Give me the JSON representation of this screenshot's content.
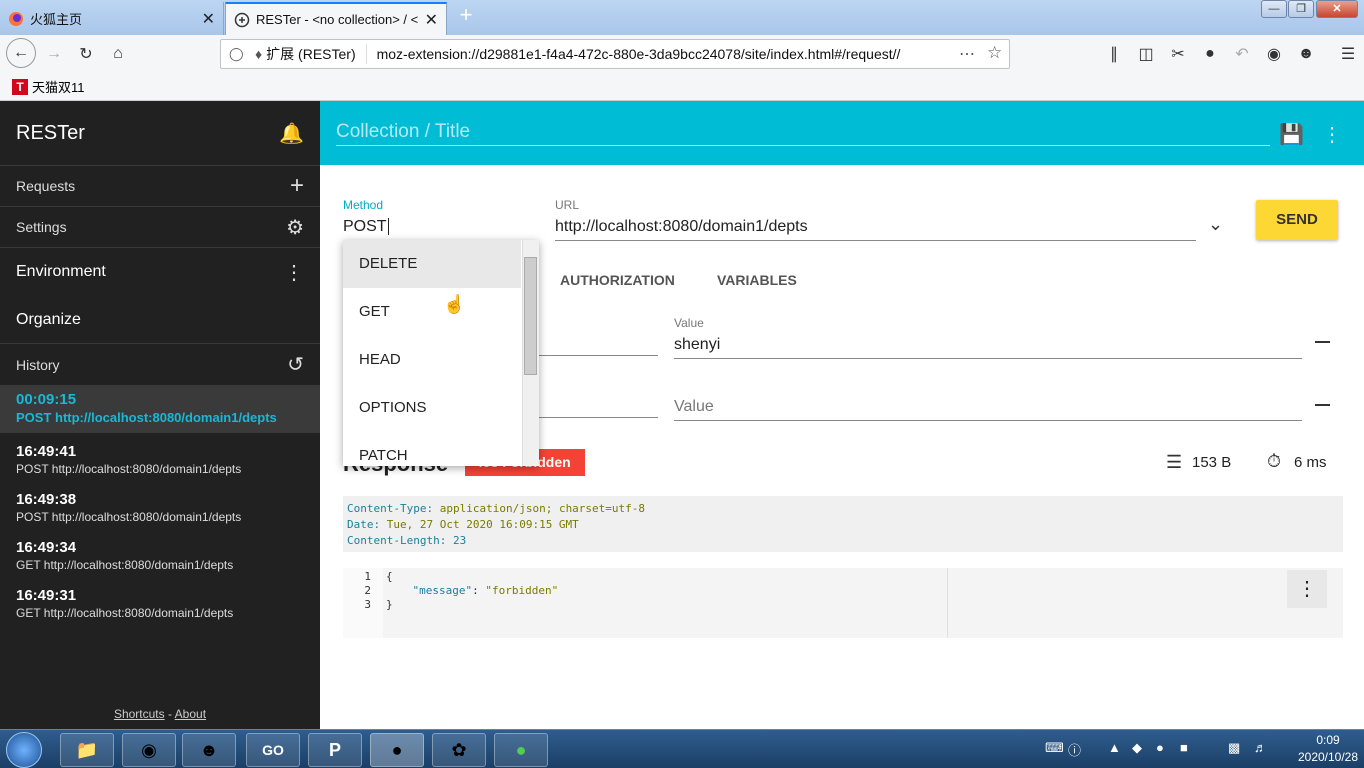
{
  "browser": {
    "tabs": [
      {
        "title": "火狐主页",
        "close": "✕"
      },
      {
        "title": "RESTer - <no collection> / <",
        "close": "✕"
      }
    ],
    "new_tab": "+",
    "window_buttons": {
      "minimize": "—",
      "maximize": "❐",
      "close": "✕"
    },
    "url_ext_label": "扩展 (RESTer)",
    "url": "moz-extension://d29881e1-f4a4-472c-880e-3da9bcc24078/site/index.html#/request//",
    "bookmark": "天猫双11"
  },
  "sidebar": {
    "app_title": "RESTer",
    "requests": "Requests",
    "settings": "Settings",
    "environment": "Environment",
    "organize": "Organize",
    "history": "History",
    "history_items": [
      {
        "time": "00:09:15",
        "request": "POST http://localhost:8080/domain1/depts"
      },
      {
        "time": "16:49:41",
        "request": "POST http://localhost:8080/domain1/depts"
      },
      {
        "time": "16:49:38",
        "request": "POST http://localhost:8080/domain1/depts"
      },
      {
        "time": "16:49:34",
        "request": "GET http://localhost:8080/domain1/depts"
      },
      {
        "time": "16:49:31",
        "request": "GET http://localhost:8080/domain1/depts"
      }
    ],
    "footer_shortcuts": "Shortcuts",
    "footer_sep": " - ",
    "footer_about": "About"
  },
  "header": {
    "title_placeholder": "Collection / Title"
  },
  "request": {
    "method_label": "Method",
    "method_value": "POST",
    "url_label": "URL",
    "url_value": "http://localhost:8080/domain1/depts",
    "send": "SEND",
    "tabs": [
      "AUTHORIZATION",
      "VARIABLES"
    ],
    "value_label": "Value",
    "param_value": "shenyi",
    "value_placeholder": "Value"
  },
  "method_options": [
    "DELETE",
    "GET",
    "HEAD",
    "OPTIONS",
    "PATCH"
  ],
  "response": {
    "title": "Response",
    "status": "403 Forbidden",
    "size": "153 B",
    "time": "6 ms",
    "headers": [
      {
        "key": "Content-Type",
        "value": "application/json; charset=utf-8"
      },
      {
        "key": "Date",
        "value": "Tue, 27 Oct 2020 16:09:15 GMT"
      },
      {
        "key": "Content-Length",
        "value": "23"
      }
    ],
    "line_numbers": [
      "1",
      "2",
      "3"
    ],
    "body_open": "{",
    "body_key": "\"message\"",
    "body_colon": ": ",
    "body_value": "\"forbidden\"",
    "body_close": "}"
  },
  "taskbar": {
    "time": "0:09",
    "date": "2020/10/28"
  },
  "colors": {
    "accent": "#00bcd4",
    "sidebar": "#212121",
    "send": "#fdd835",
    "error": "#f44336",
    "history_active": "#19b8d6"
  }
}
